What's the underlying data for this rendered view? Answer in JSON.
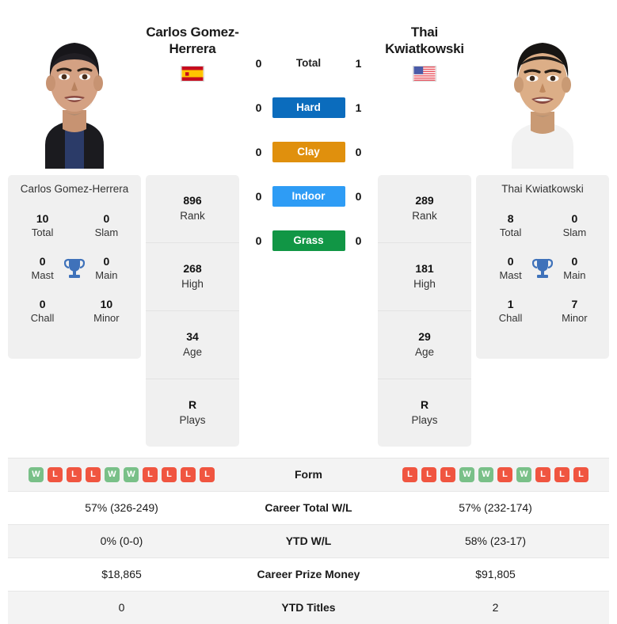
{
  "players": {
    "left": {
      "name": "Carlos Gomez-Herrera",
      "name_line1": "Carlos Gomez-",
      "name_line2": "Herrera",
      "flag": "spain-flag",
      "rank": "896",
      "rank_label": "Rank",
      "high": "268",
      "high_label": "High",
      "age": "34",
      "age_label": "Age",
      "plays": "R",
      "plays_label": "Plays",
      "titles": {
        "total": "10",
        "total_label": "Total",
        "slam": "0",
        "slam_label": "Slam",
        "mast": "0",
        "mast_label": "Mast",
        "main": "0",
        "main_label": "Main",
        "chall": "0",
        "chall_label": "Chall",
        "minor": "10",
        "minor_label": "Minor"
      },
      "form": [
        "W",
        "L",
        "L",
        "L",
        "W",
        "W",
        "L",
        "L",
        "L",
        "L"
      ],
      "career_wl": "57% (326-249)",
      "ytd_wl": "0% (0-0)",
      "prize_money": "$18,865",
      "ytd_titles": "0"
    },
    "right": {
      "name": "Thai Kwiatkowski",
      "name_line1": "Thai",
      "name_line2": "Kwiatkowski",
      "flag": "usa-flag",
      "rank": "289",
      "rank_label": "Rank",
      "high": "181",
      "high_label": "High",
      "age": "29",
      "age_label": "Age",
      "plays": "R",
      "plays_label": "Plays",
      "titles": {
        "total": "8",
        "total_label": "Total",
        "slam": "0",
        "slam_label": "Slam",
        "mast": "0",
        "mast_label": "Mast",
        "main": "0",
        "main_label": "Main",
        "chall": "1",
        "chall_label": "Chall",
        "minor": "7",
        "minor_label": "Minor"
      },
      "form": [
        "L",
        "L",
        "L",
        "W",
        "W",
        "L",
        "W",
        "L",
        "L",
        "L"
      ],
      "career_wl": "57% (232-174)",
      "ytd_wl": "58% (23-17)",
      "prize_money": "$91,805",
      "ytd_titles": "2"
    }
  },
  "h2h": {
    "rows": [
      {
        "label": "Total",
        "left": "0",
        "right": "1",
        "color": ""
      },
      {
        "label": "Hard",
        "left": "0",
        "right": "1",
        "color": "#0b6cbd"
      },
      {
        "label": "Clay",
        "left": "0",
        "right": "0",
        "color": "#e0900d"
      },
      {
        "label": "Indoor",
        "left": "0",
        "right": "0",
        "color": "#2e9cf5"
      },
      {
        "label": "Grass",
        "left": "0",
        "right": "0",
        "color": "#119645"
      }
    ]
  },
  "table": {
    "rows": [
      {
        "label": "Form",
        "type": "form"
      },
      {
        "label": "Career Total W/L",
        "type": "text",
        "key": "career_wl"
      },
      {
        "label": "YTD W/L",
        "type": "text",
        "key": "ytd_wl"
      },
      {
        "label": "Career Prize Money",
        "type": "text",
        "key": "prize_money"
      },
      {
        "label": "YTD Titles",
        "type": "text",
        "key": "ytd_titles"
      }
    ]
  }
}
